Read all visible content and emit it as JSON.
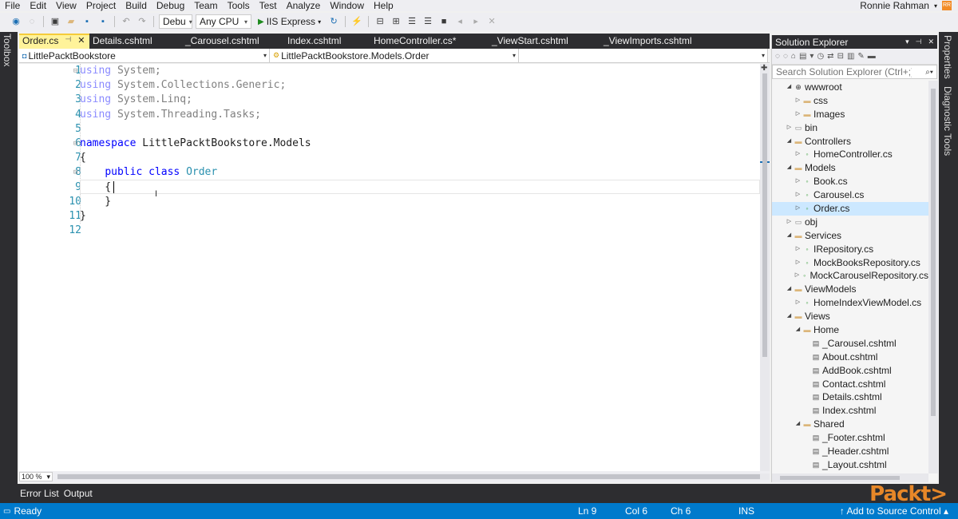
{
  "menu": [
    "File",
    "Edit",
    "View",
    "Project",
    "Build",
    "Debug",
    "Team",
    "Tools",
    "Test",
    "Analyze",
    "Window",
    "Help"
  ],
  "user": {
    "name": "Ronnie Rahman",
    "icon_label": "RR"
  },
  "toolbar": {
    "config": "Debu",
    "platform": "Any CPU",
    "run_label": "IIS Express"
  },
  "side_tabs": {
    "left": "Toolbox",
    "right": [
      "Properties",
      "Diagnostic Tools"
    ]
  },
  "editor_tabs": [
    {
      "label": "Order.cs",
      "active": true
    },
    {
      "label": "Details.cshtml",
      "active": false
    },
    {
      "label": "_Carousel.cshtml",
      "active": false
    },
    {
      "label": "Index.cshtml",
      "active": false
    },
    {
      "label": "HomeController.cs*",
      "active": false
    },
    {
      "label": "_ViewStart.cshtml",
      "active": false
    },
    {
      "label": "_ViewImports.cshtml",
      "active": false
    }
  ],
  "navbar": {
    "project": "LittlePacktBookstore",
    "type": "LittlePacktBookstore.Models.Order",
    "member": ""
  },
  "code": {
    "line_numbers": [
      "1",
      "2",
      "3",
      "4",
      "5",
      "6",
      "7",
      "8",
      "9",
      "10",
      "11",
      "12"
    ],
    "lines": [
      {
        "kw": "using",
        "rest": " System;"
      },
      {
        "kw": "using",
        "rest": " System.Collections.Generic;"
      },
      {
        "kw": "using",
        "rest": " System.Linq;"
      },
      {
        "kw": "using",
        "rest": " System.Threading.Tasks;"
      },
      {
        "kw": "",
        "rest": ""
      },
      {
        "kw": "namespace",
        "rest": " LittlePacktBookstore.Models"
      },
      {
        "kw": "",
        "rest": "{"
      },
      {
        "indent": "    ",
        "kw": "public",
        "kw2": " class",
        "type": " Order"
      },
      {
        "kw": "",
        "rest": "    {"
      },
      {
        "kw": "",
        "rest": "    }"
      },
      {
        "kw": "",
        "rest": "}"
      },
      {
        "kw": "",
        "rest": ""
      }
    ]
  },
  "zoom": "100 %",
  "solution_explorer": {
    "title": "Solution Explorer",
    "search_placeholder": "Search Solution Explorer (Ctrl+;)",
    "items": [
      {
        "label": "wwwroot",
        "depth": 1,
        "arrow": "expanded",
        "icon": "globe"
      },
      {
        "label": "css",
        "depth": 2,
        "arrow": "collapsed",
        "icon": "folder"
      },
      {
        "label": "Images",
        "depth": 2,
        "arrow": "collapsed",
        "icon": "folder"
      },
      {
        "label": "bin",
        "depth": 1,
        "arrow": "collapsed",
        "icon": "hidden-folder"
      },
      {
        "label": "Controllers",
        "depth": 1,
        "arrow": "expanded",
        "icon": "folder"
      },
      {
        "label": "HomeController.cs",
        "depth": 2,
        "arrow": "collapsed",
        "icon": "cs"
      },
      {
        "label": "Models",
        "depth": 1,
        "arrow": "expanded",
        "icon": "folder"
      },
      {
        "label": "Book.cs",
        "depth": 2,
        "arrow": "collapsed",
        "icon": "cs"
      },
      {
        "label": "Carousel.cs",
        "depth": 2,
        "arrow": "collapsed",
        "icon": "cs"
      },
      {
        "label": "Order.cs",
        "depth": 2,
        "arrow": "collapsed",
        "icon": "cs",
        "selected": true
      },
      {
        "label": "obj",
        "depth": 1,
        "arrow": "collapsed",
        "icon": "hidden-folder"
      },
      {
        "label": "Services",
        "depth": 1,
        "arrow": "expanded",
        "icon": "folder"
      },
      {
        "label": "IRepository.cs",
        "depth": 2,
        "arrow": "collapsed",
        "icon": "cs"
      },
      {
        "label": "MockBooksRepository.cs",
        "depth": 2,
        "arrow": "collapsed",
        "icon": "cs"
      },
      {
        "label": "MockCarouselRepository.cs",
        "depth": 2,
        "arrow": "collapsed",
        "icon": "cs"
      },
      {
        "label": "ViewModels",
        "depth": 1,
        "arrow": "expanded",
        "icon": "folder"
      },
      {
        "label": "HomeIndexViewModel.cs",
        "depth": 2,
        "arrow": "collapsed",
        "icon": "cs"
      },
      {
        "label": "Views",
        "depth": 1,
        "arrow": "expanded",
        "icon": "folder"
      },
      {
        "label": "Home",
        "depth": 2,
        "arrow": "expanded",
        "icon": "folder"
      },
      {
        "label": "_Carousel.cshtml",
        "depth": 3,
        "arrow": "none",
        "icon": "file"
      },
      {
        "label": "About.cshtml",
        "depth": 3,
        "arrow": "none",
        "icon": "file"
      },
      {
        "label": "AddBook.cshtml",
        "depth": 3,
        "arrow": "none",
        "icon": "file"
      },
      {
        "label": "Contact.cshtml",
        "depth": 3,
        "arrow": "none",
        "icon": "file"
      },
      {
        "label": "Details.cshtml",
        "depth": 3,
        "arrow": "none",
        "icon": "file"
      },
      {
        "label": "Index.cshtml",
        "depth": 3,
        "arrow": "none",
        "icon": "file"
      },
      {
        "label": "Shared",
        "depth": 2,
        "arrow": "expanded",
        "icon": "folder"
      },
      {
        "label": "_Footer.cshtml",
        "depth": 3,
        "arrow": "none",
        "icon": "file"
      },
      {
        "label": "_Header.cshtml",
        "depth": 3,
        "arrow": "none",
        "icon": "file"
      },
      {
        "label": "_Layout.cshtml",
        "depth": 3,
        "arrow": "none",
        "icon": "file"
      }
    ]
  },
  "bottom_tabs": [
    "Error List",
    "Output"
  ],
  "status": {
    "ready": "Ready",
    "ln": "Ln 9",
    "col": "Col 6",
    "ch": "Ch 6",
    "mode": "INS",
    "source_control": "Add to Source Control"
  },
  "watermark": "Packt>",
  "colors": {
    "status_bar": "#007acc",
    "active_tab": "#fff39a",
    "keyword": "#0000ff",
    "type": "#2b91af",
    "line_number": "#2b91af"
  }
}
